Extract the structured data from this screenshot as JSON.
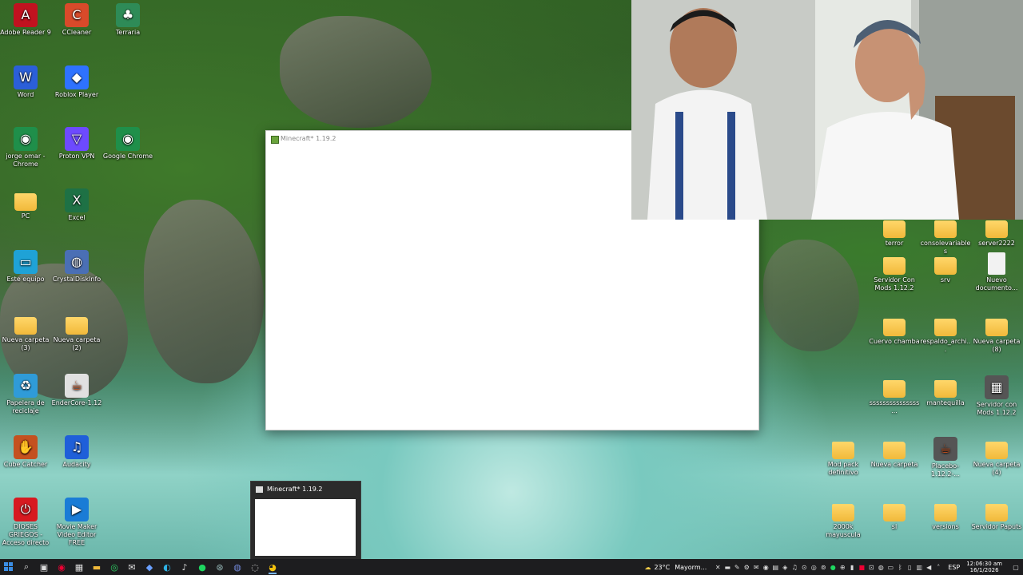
{
  "desktop_icons_left": [
    {
      "label": "Adobe Reader 9",
      "icon": "pdf-icon",
      "color": "#c1121f"
    },
    {
      "label": "CCleaner",
      "icon": "ccleaner-icon",
      "color": "#d94a2a"
    },
    {
      "label": "Terraria",
      "icon": "tree-icon",
      "color": "#2e8b57"
    },
    {
      "label": "Word",
      "icon": "word-icon",
      "color": "#2b5fd9"
    },
    {
      "label": "Roblox Player",
      "icon": "roblox-icon",
      "color": "#2e72ff"
    },
    {
      "label": "jorge omar - Chrome",
      "icon": "chrome-icon",
      "color": "#1f8f4a"
    },
    {
      "label": "Proton VPN",
      "icon": "vpn-icon",
      "color": "#6d4aff"
    },
    {
      "label": "Google Chrome",
      "icon": "chrome-icon",
      "color": "#1f8f4a"
    },
    {
      "label": "PC",
      "icon": "folder-icon",
      "color": "#f1b93a"
    },
    {
      "label": "Excel",
      "icon": "excel-icon",
      "color": "#1e7145"
    },
    {
      "label": "Este equipo",
      "icon": "monitor-icon",
      "color": "#1fa2d6"
    },
    {
      "label": "CrystalDiskInfo",
      "icon": "disk-icon",
      "color": "#4a6fb5"
    },
    {
      "label": "Nueva carpeta (3)",
      "icon": "folder-icon",
      "color": "#f1b93a"
    },
    {
      "label": "Nueva carpeta (2)",
      "icon": "folder-icon",
      "color": "#f1b93a"
    },
    {
      "label": "Papelera de reciclaje",
      "icon": "recycle-bin-icon",
      "color": "#2f9bd8"
    },
    {
      "label": "EnderCore-1.12",
      "icon": "java-icon",
      "color": "#e0e0e0"
    },
    {
      "label": "Cube Catcher",
      "icon": "glove-icon",
      "color": "#c4511f"
    },
    {
      "label": "Audacity",
      "icon": "headphones-icon",
      "color": "#1f5fd9"
    },
    {
      "label": "DIOSES GRIEGOS - Acceso directo",
      "icon": "power-icon",
      "color": "#d71920"
    },
    {
      "label": "Movie Maker Video Editor FREE",
      "icon": "movie-icon",
      "color": "#1a7cd6"
    }
  ],
  "desktop_icons_right": [
    {
      "label": "terror",
      "icon": "folder-icon"
    },
    {
      "label": "consolevariables",
      "icon": "folder-icon"
    },
    {
      "label": "server2222",
      "icon": "folder-icon"
    },
    {
      "label": "Servidor Con Mods 1.12.2",
      "icon": "folder-icon"
    },
    {
      "label": "srv",
      "icon": "folder-icon"
    },
    {
      "label": "Nuevo documento...",
      "icon": "document-icon"
    },
    {
      "label": "Cuervo chamba",
      "icon": "folder-icon"
    },
    {
      "label": "respaldo_archi...",
      "icon": "folder-icon"
    },
    {
      "label": "Nueva carpeta (8)",
      "icon": "folder-icon"
    },
    {
      "label": "sssssssssssssss...",
      "icon": "folder-icon"
    },
    {
      "label": "mantequilla",
      "icon": "folder-icon"
    },
    {
      "label": "Servidor con Mods 1.12.2",
      "icon": "winrar-icon"
    },
    {
      "label": "Mod pack definitivo",
      "icon": "folder-icon"
    },
    {
      "label": "Nueva carpeta",
      "icon": "folder-icon"
    },
    {
      "label": "Placebo-1.12.2-...",
      "icon": "java-icon"
    },
    {
      "label": "Nueva carpeta (4)",
      "icon": "folder-icon"
    },
    {
      "label": "2000k mayuscula",
      "icon": "folder-icon"
    },
    {
      "label": "sl",
      "icon": "folder-icon"
    },
    {
      "label": "versions",
      "icon": "folder-icon"
    },
    {
      "label": "Servidor Paputs",
      "icon": "folder-icon"
    }
  ],
  "minecraft_window": {
    "title": "Minecraft* 1.19.2"
  },
  "taskbar_preview": {
    "title": "Minecraft* 1.19.2"
  },
  "taskbar": {
    "weather_temp": "23°C",
    "weather_text": "Mayorm...",
    "language": "ESP",
    "time": "12:06:30 am",
    "date": "16/1/2026"
  }
}
